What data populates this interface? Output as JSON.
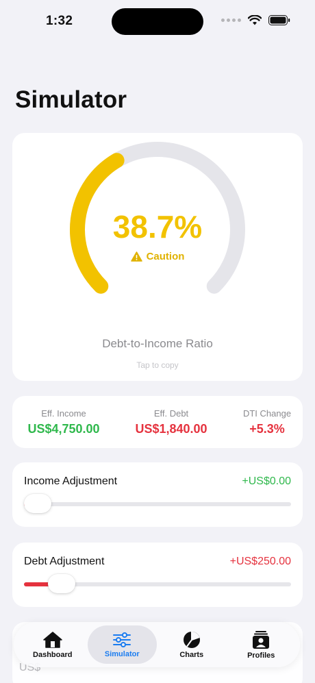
{
  "status_bar": {
    "time": "1:32"
  },
  "page": {
    "title": "Simulator"
  },
  "gauge": {
    "value_text": "38.7%",
    "fill_fraction": 0.387,
    "status": "Caution",
    "label": "Debt-to-Income Ratio",
    "hint": "Tap to copy",
    "fill_color": "#F2C200",
    "track_color": "#E5E5EA"
  },
  "stats": [
    {
      "label": "Eff. Income",
      "value": "US$4,750.00",
      "tone": "green"
    },
    {
      "label": "Eff. Debt",
      "value": "US$1,840.00",
      "tone": "red"
    },
    {
      "label": "DTI Change",
      "value": "+5.3%",
      "tone": "red"
    }
  ],
  "sliders": [
    {
      "title": "Income Adjustment",
      "amount": "+US$0.00",
      "tone": "green",
      "position": 0.0
    },
    {
      "title": "Debt Adjustment",
      "amount": "+US$250.00",
      "tone": "red",
      "position": 0.09
    }
  ],
  "peek": {
    "text": "US$"
  },
  "tabbar": {
    "tabs": [
      {
        "label": "Dashboard",
        "icon": "house-icon",
        "active": false
      },
      {
        "label": "Simulator",
        "icon": "sliders-icon",
        "active": true
      },
      {
        "label": "Charts",
        "icon": "pie-chart-icon",
        "active": false
      },
      {
        "label": "Profiles",
        "icon": "person-card-icon",
        "active": false
      }
    ]
  },
  "colors": {
    "accent": "#1A7CF0",
    "positive": "#2FB84C",
    "negative": "#E5323E",
    "caution": "#F2C200"
  }
}
